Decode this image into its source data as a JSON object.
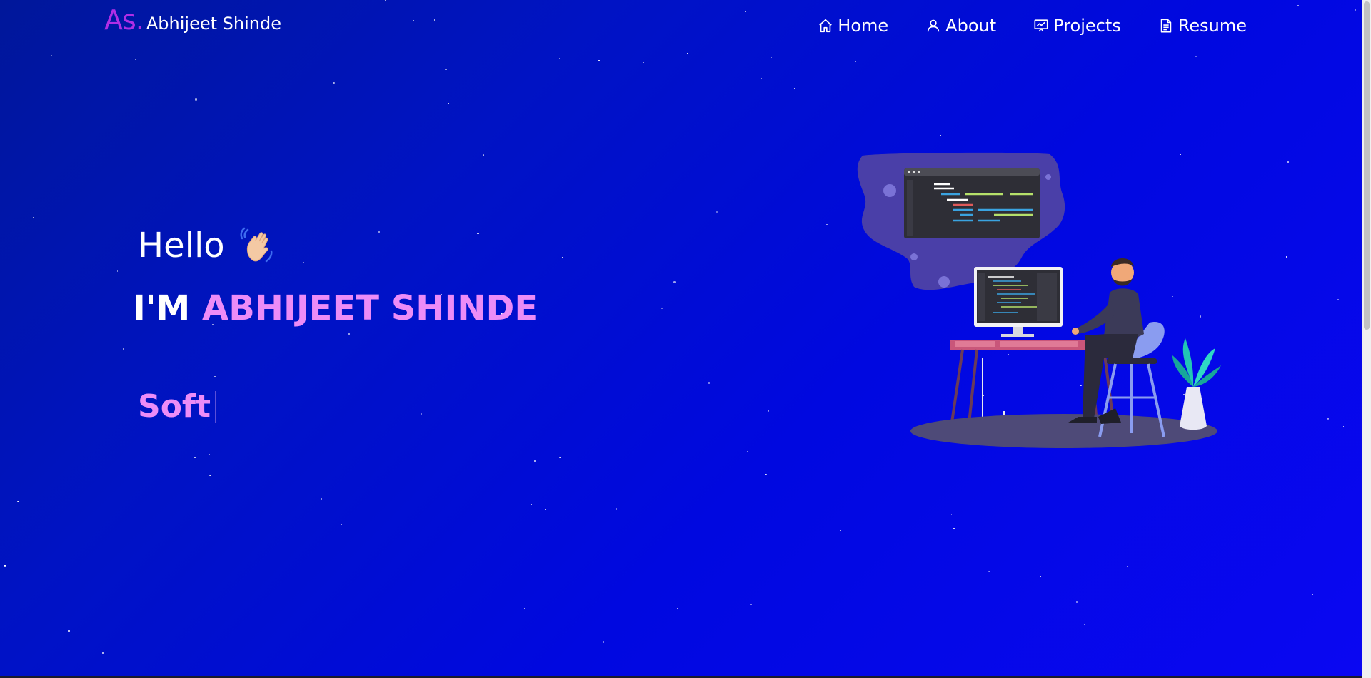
{
  "brand": {
    "mark": "As.",
    "name": "Abhijeet Shinde"
  },
  "nav": {
    "items": [
      {
        "label": "Home",
        "icon": "home-icon"
      },
      {
        "label": "About",
        "icon": "user-icon"
      },
      {
        "label": "Projects",
        "icon": "projects-icon"
      },
      {
        "label": "Resume",
        "icon": "document-icon"
      }
    ]
  },
  "hero": {
    "hello": "Hello",
    "wave_icon": "waving-hand-icon",
    "im": "I'M",
    "name": "ABHIJEET SHINDE",
    "typing": "Soft"
  },
  "illustration": {
    "icon": "developer-at-desk-illustration"
  },
  "colors": {
    "accent": "#ec8cf7",
    "brand_mark": "#b02ee6",
    "background": "#0013c4"
  }
}
